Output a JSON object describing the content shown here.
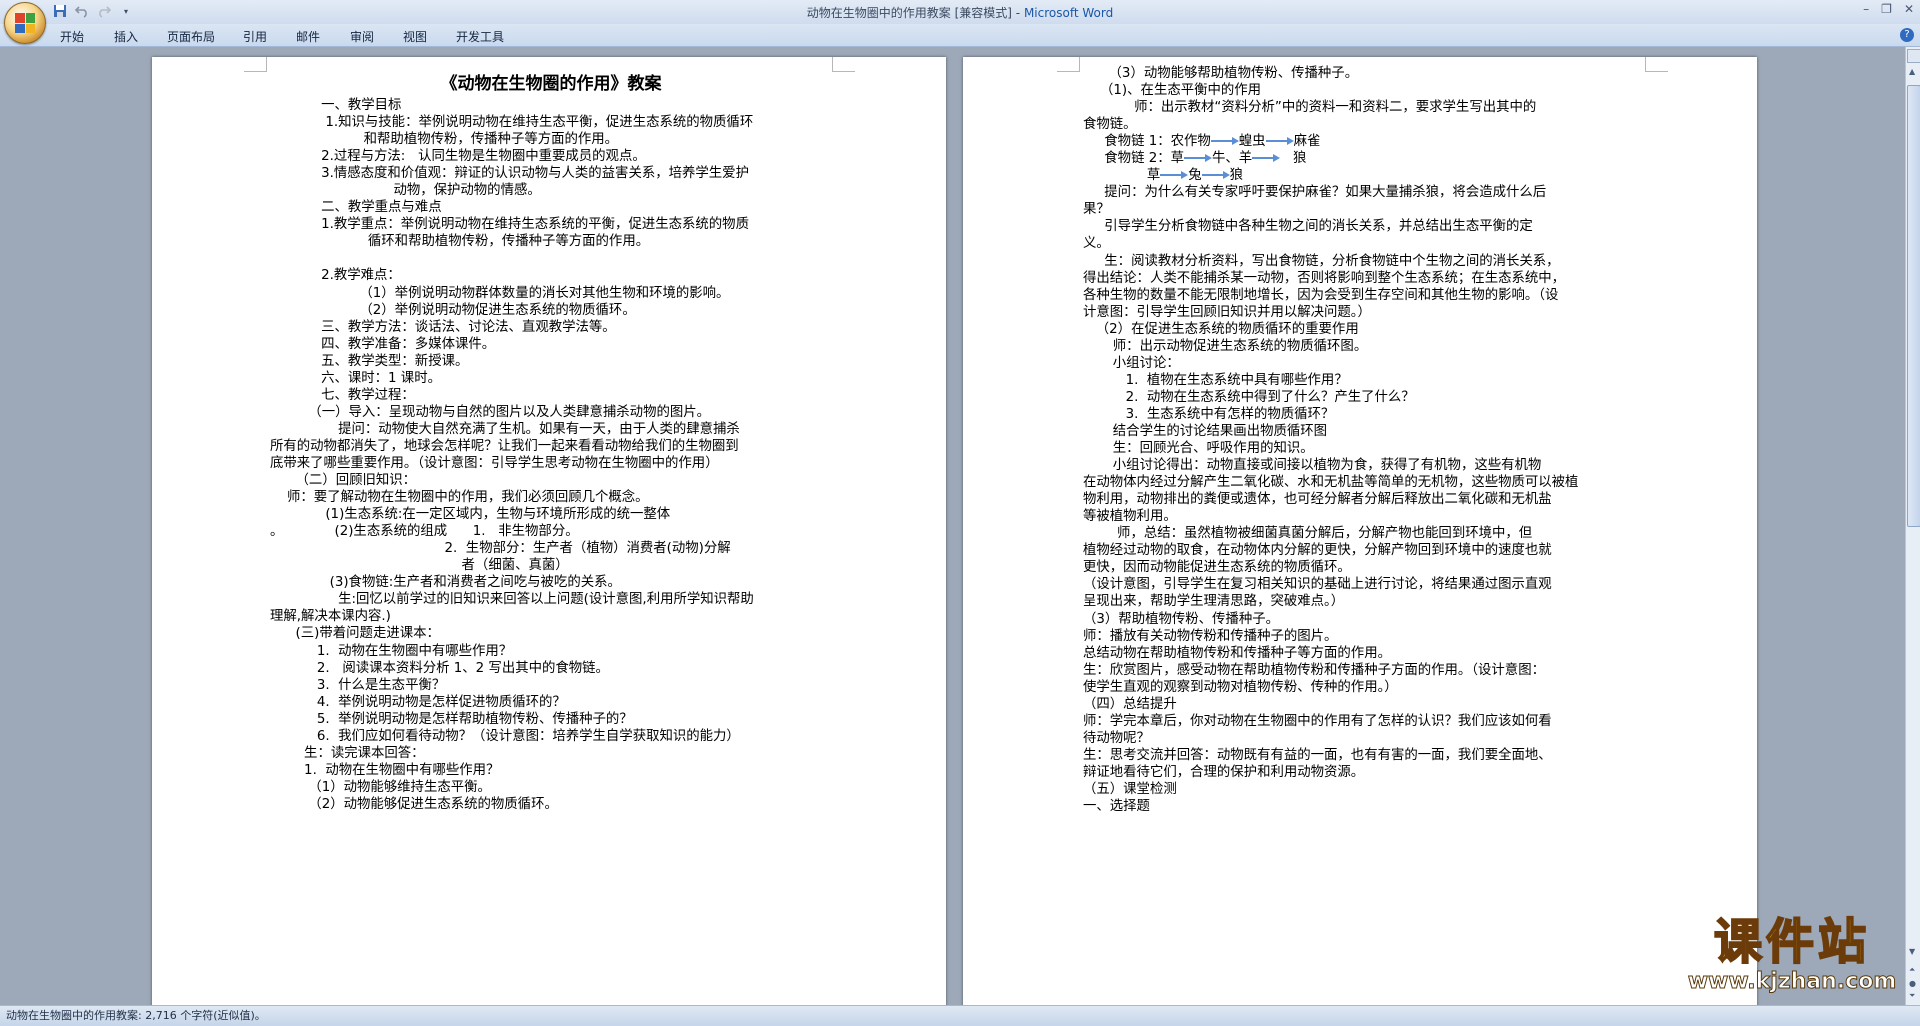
{
  "window": {
    "title_doc": "动物在生物圈中的作用教案 [兼容模式]",
    "title_sep": " - ",
    "title_app": "Microsoft Word",
    "minimize_glyph": "–",
    "maximize_glyph": "❐",
    "close_glyph": "✕"
  },
  "quick_access": {
    "save_icon": "save-icon",
    "undo_icon": "undo-icon",
    "redo_icon": "redo-icon"
  },
  "ribbon_tabs": [
    "开始",
    "插入",
    "页面布局",
    "引用",
    "邮件",
    "审阅",
    "视图",
    "开发工具"
  ],
  "help_glyph": "?",
  "page1": {
    "title": "《动物在生物圈的作用》教案",
    "lines": [
      "            一、教学目标",
      "             1.知识与技能：举例说明动物在维持生态平衡，促进生态系统的物质循环",
      "                      和帮助植物传粉，传播种子等方面的作用。",
      "            2.过程与方法:   认同生物是生物圈中重要成员的观点。",
      "            3.情感态度和价值观：辩证的认识动物与人类的益害关系，培养学生爱护",
      "                             动物，保护动物的情感。",
      "            二、教学重点与难点",
      "            1.教学重点：举例说明动物在维持生态系统的平衡，促进生态系统的物质",
      "                       循环和帮助植物传粉，传播种子等方面的作用。",
      "",
      "            2.教学难点：",
      "                     （1）举例说明动物群体数量的消长对其他生物和环境的影响。",
      "                     （2）举例说明动物促进生态系统的物质循环。",
      "            三、教学方法：谈话法、讨论法、直观教学法等。",
      "            四、教学准备：多媒体课件。",
      "            五、教学类型：新授课。",
      "            六、课时：1 课时。",
      "            七、教学过程：",
      "         （一）导入：呈现动物与自然的图片以及人类肆意捕杀动物的图片。",
      "                提问：动物使大自然充满了生机。如果有一天，由于人类的肆意捕杀",
      "所有的动物都消失了，地球会怎样呢？让我们一起来看看动物给我们的生物圈到",
      "底带来了哪些重要作用。（设计意图：引导学生思考动物在生物圈中的作用）",
      "      （二）回顾旧知识：",
      "    师：要了解动物在生物圈中的作用，我们必须回顾几个概念。",
      "             (1)生态系统:在一定区域内，生物与环境所形成的统一整体",
      "。            (2)生态系统的组成      1.   非生物部分。",
      "                                         2.  生物部分：生产者（植物）消费者(动物)分解",
      "                                             者（细菌、真菌）",
      "              (3)食物链:生产者和消费者之间吃与被吃的关系。",
      "                生:回忆以前学过的旧知识来回答以上问题(设计意图,利用所学知识帮助",
      "理解,解决本课内容.)",
      "      (三)带着问题走进课本：",
      "           1.  动物在生物圈中有哪些作用？",
      "           2.   阅读课本资料分析 1、2 写出其中的食物链。",
      "           3.  什么是生态平衡？",
      "           4.  举例说明动物是怎样促进物质循环的？",
      "           5.  举例说明动物是怎样帮助植物传粉、传播种子的？",
      "           6.  我们应如何看待动物？（设计意图：培养学生自学获取知识的能力）",
      "        生：读完课本回答：",
      "        1.  动物在生物圈中有哪些作用？",
      "         （1）动物能够维持生态平衡。",
      "         （2）动物能够促进生态系统的物质循环。"
    ]
  },
  "page2": {
    "lines_a": [
      "      （3）动物能够帮助植物传粉、传播种子。",
      "    （1)、在生态平衡中的作用",
      "            师：出示教材“资料分析”中的资料一和资料二，要求学生写出其中的",
      "食物链。"
    ],
    "food_chains": {
      "c1_label": "     食物链 1：农作物",
      "c1_b": "蝗虫",
      "c1_c": "麻雀",
      "c2_label": "     食物链 2：草",
      "c2_b": "牛、羊",
      "c2_c": "狼",
      "c3_a": "               草",
      "c3_b": "兔",
      "c3_c": "狼"
    },
    "lines_b": [
      "     提问：为什么有关专家呼吁要保护麻雀？如果大量捕杀狼，将会造成什么后",
      "果？",
      "     引导学生分析食物链中各种生物之间的消长关系，并总结出生态平衡的定",
      "义。",
      "     生：阅读教材分析资料，写出食物链，分析食物链中个生物之间的消长关系，",
      "得出结论：人类不能捕杀某一动物，否则将影响到整个生态系统；在生态系统中，",
      "各种生物的数量不能无限制地增长，因为会受到生存空间和其他生物的影响。（设",
      "计意图：引导学生回顾旧知识并用以解决问题。）",
      "   （2）在促进生态系统的物质循环的重要作用",
      "       师：出示动物促进生态系统的物质循环图。",
      "       小组讨论：",
      "          1.  植物在生态系统中具有哪些作用？",
      "          2.  动物在生态系统中得到了什么？产生了什么？",
      "          3.  生态系统中有怎样的物质循环？",
      "       结合学生的讨论结果画出物质循环图",
      "       生：回顾光合、呼吸作用的知识。",
      "       小组讨论得出：动物直接或间接以植物为食，获得了有机物，这些有机物",
      "在动物体内经过分解产生二氧化碳、水和无机盐等简单的无机物，这些物质可以被植",
      "物利用，动物排出的粪便或遗体，也可经分解者分解后释放出二氧化碳和无机盐",
      "等被植物利用。",
      "        师，总结：虽然植物被细菌真菌分解后，分解产物也能回到环境中，但",
      "植物经过动物的取食，在动物体内分解的更快，分解产物回到环境中的速度也就",
      "更快，因而动物能促进生态系统的物质循环。",
      "（设计意图，引导学生在复习相关知识的基础上进行讨论，将结果通过图示直观",
      "呈现出来，帮助学生理清思路，突破难点。）",
      "（3）帮助植物传粉、传播种子。",
      "师：播放有关动物传粉和传播种子的图片。",
      "总结动物在帮助植物传粉和传播种子等方面的作用。",
      "生：欣赏图片，感受动物在帮助植物传粉和传播种子方面的作用。（设计意图：",
      "使学生直观的观察到动物对植物传粉、传种的作用。）",
      "（四）总结提升",
      "师：学完本章后，你对动物在生物圈中的作用有了怎样的认识？我们应该如何看",
      "待动物呢？",
      "生：思考交流并回答：动物既有有益的一面，也有有害的一面，我们要全面地、",
      "辩证地看待它们，合理的保护和利用动物资源。",
      "（五）课堂检测",
      "一、选择题"
    ]
  },
  "status_bar": {
    "text": "动物在生物圈中的作用教案: 2,716 个字符(近似值)。"
  },
  "watermark": {
    "name": "课件站",
    "url": "www.kjzhan.com"
  },
  "colors": {
    "accent": "#1b57a7",
    "background": "#9da9b9",
    "arrow": "#5a8fd6",
    "watermark": "#f4c90b"
  }
}
